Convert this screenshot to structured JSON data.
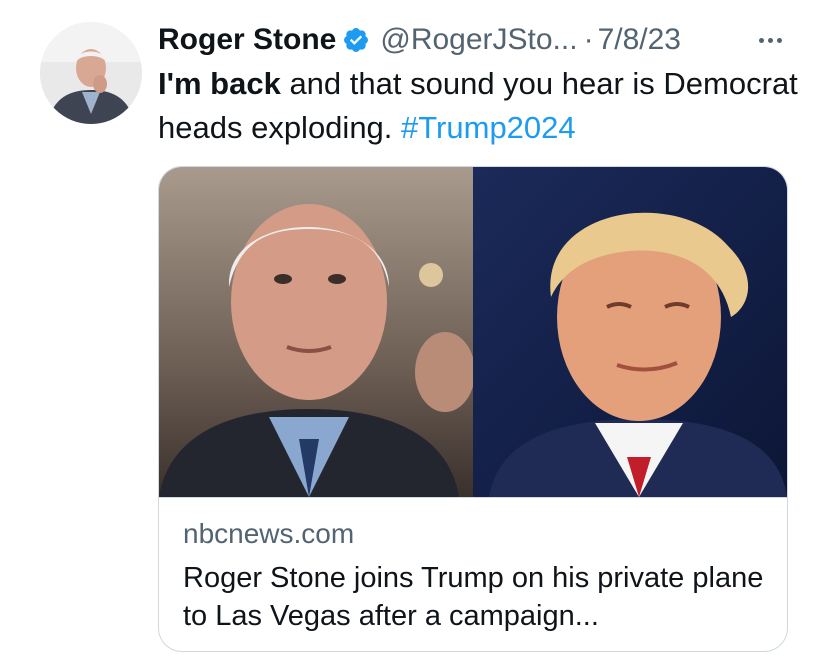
{
  "tweet": {
    "author": {
      "display_name": "Roger Stone",
      "handle": "@RogerJSto...",
      "verified": true
    },
    "separator": "·",
    "date": "7/8/23",
    "text": {
      "bold_part": "I'm back",
      "rest": " and that sound you hear is Democrat heads exploding. ",
      "hashtag": "#Trump2024"
    },
    "card": {
      "domain": "nbcnews.com",
      "title": "Roger Stone joins Trump on his private plane to Las Vegas after a campaign..."
    }
  },
  "icons": {
    "verified": "verified-badge-icon",
    "more": "more-options-icon"
  },
  "colors": {
    "link_blue": "#1d9bf0",
    "secondary_text": "#536471",
    "border": "#cfd9de"
  }
}
